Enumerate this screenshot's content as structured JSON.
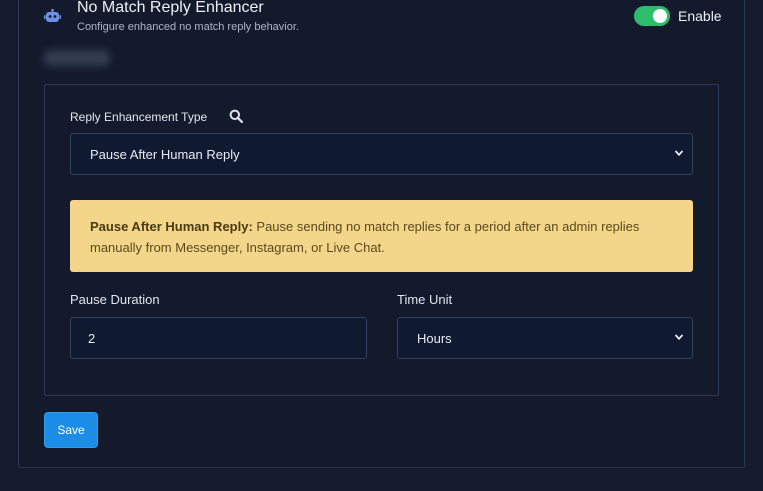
{
  "header": {
    "title": "No Match Reply Enhancer",
    "subtitle": "Configure enhanced no match reply behavior.",
    "icon": "robot-icon",
    "toggle_label": "Enable",
    "toggle_on": true,
    "toggle_color": "#2ebd6b"
  },
  "form": {
    "type_label": "Reply Enhancement Type",
    "type_value": "Pause After Human Reply",
    "alert_title": "Pause After Human Reply:",
    "alert_text": "Pause sending no match replies for a period after an admin replies manually from Messenger, Instagram, or Live Chat.",
    "alert_color": "#f3d68a",
    "duration_label": "Pause Duration",
    "duration_value": "2",
    "unit_label": "Time Unit",
    "unit_value": "Hours"
  },
  "actions": {
    "save_label": "Save",
    "save_color": "#1b8de6"
  }
}
